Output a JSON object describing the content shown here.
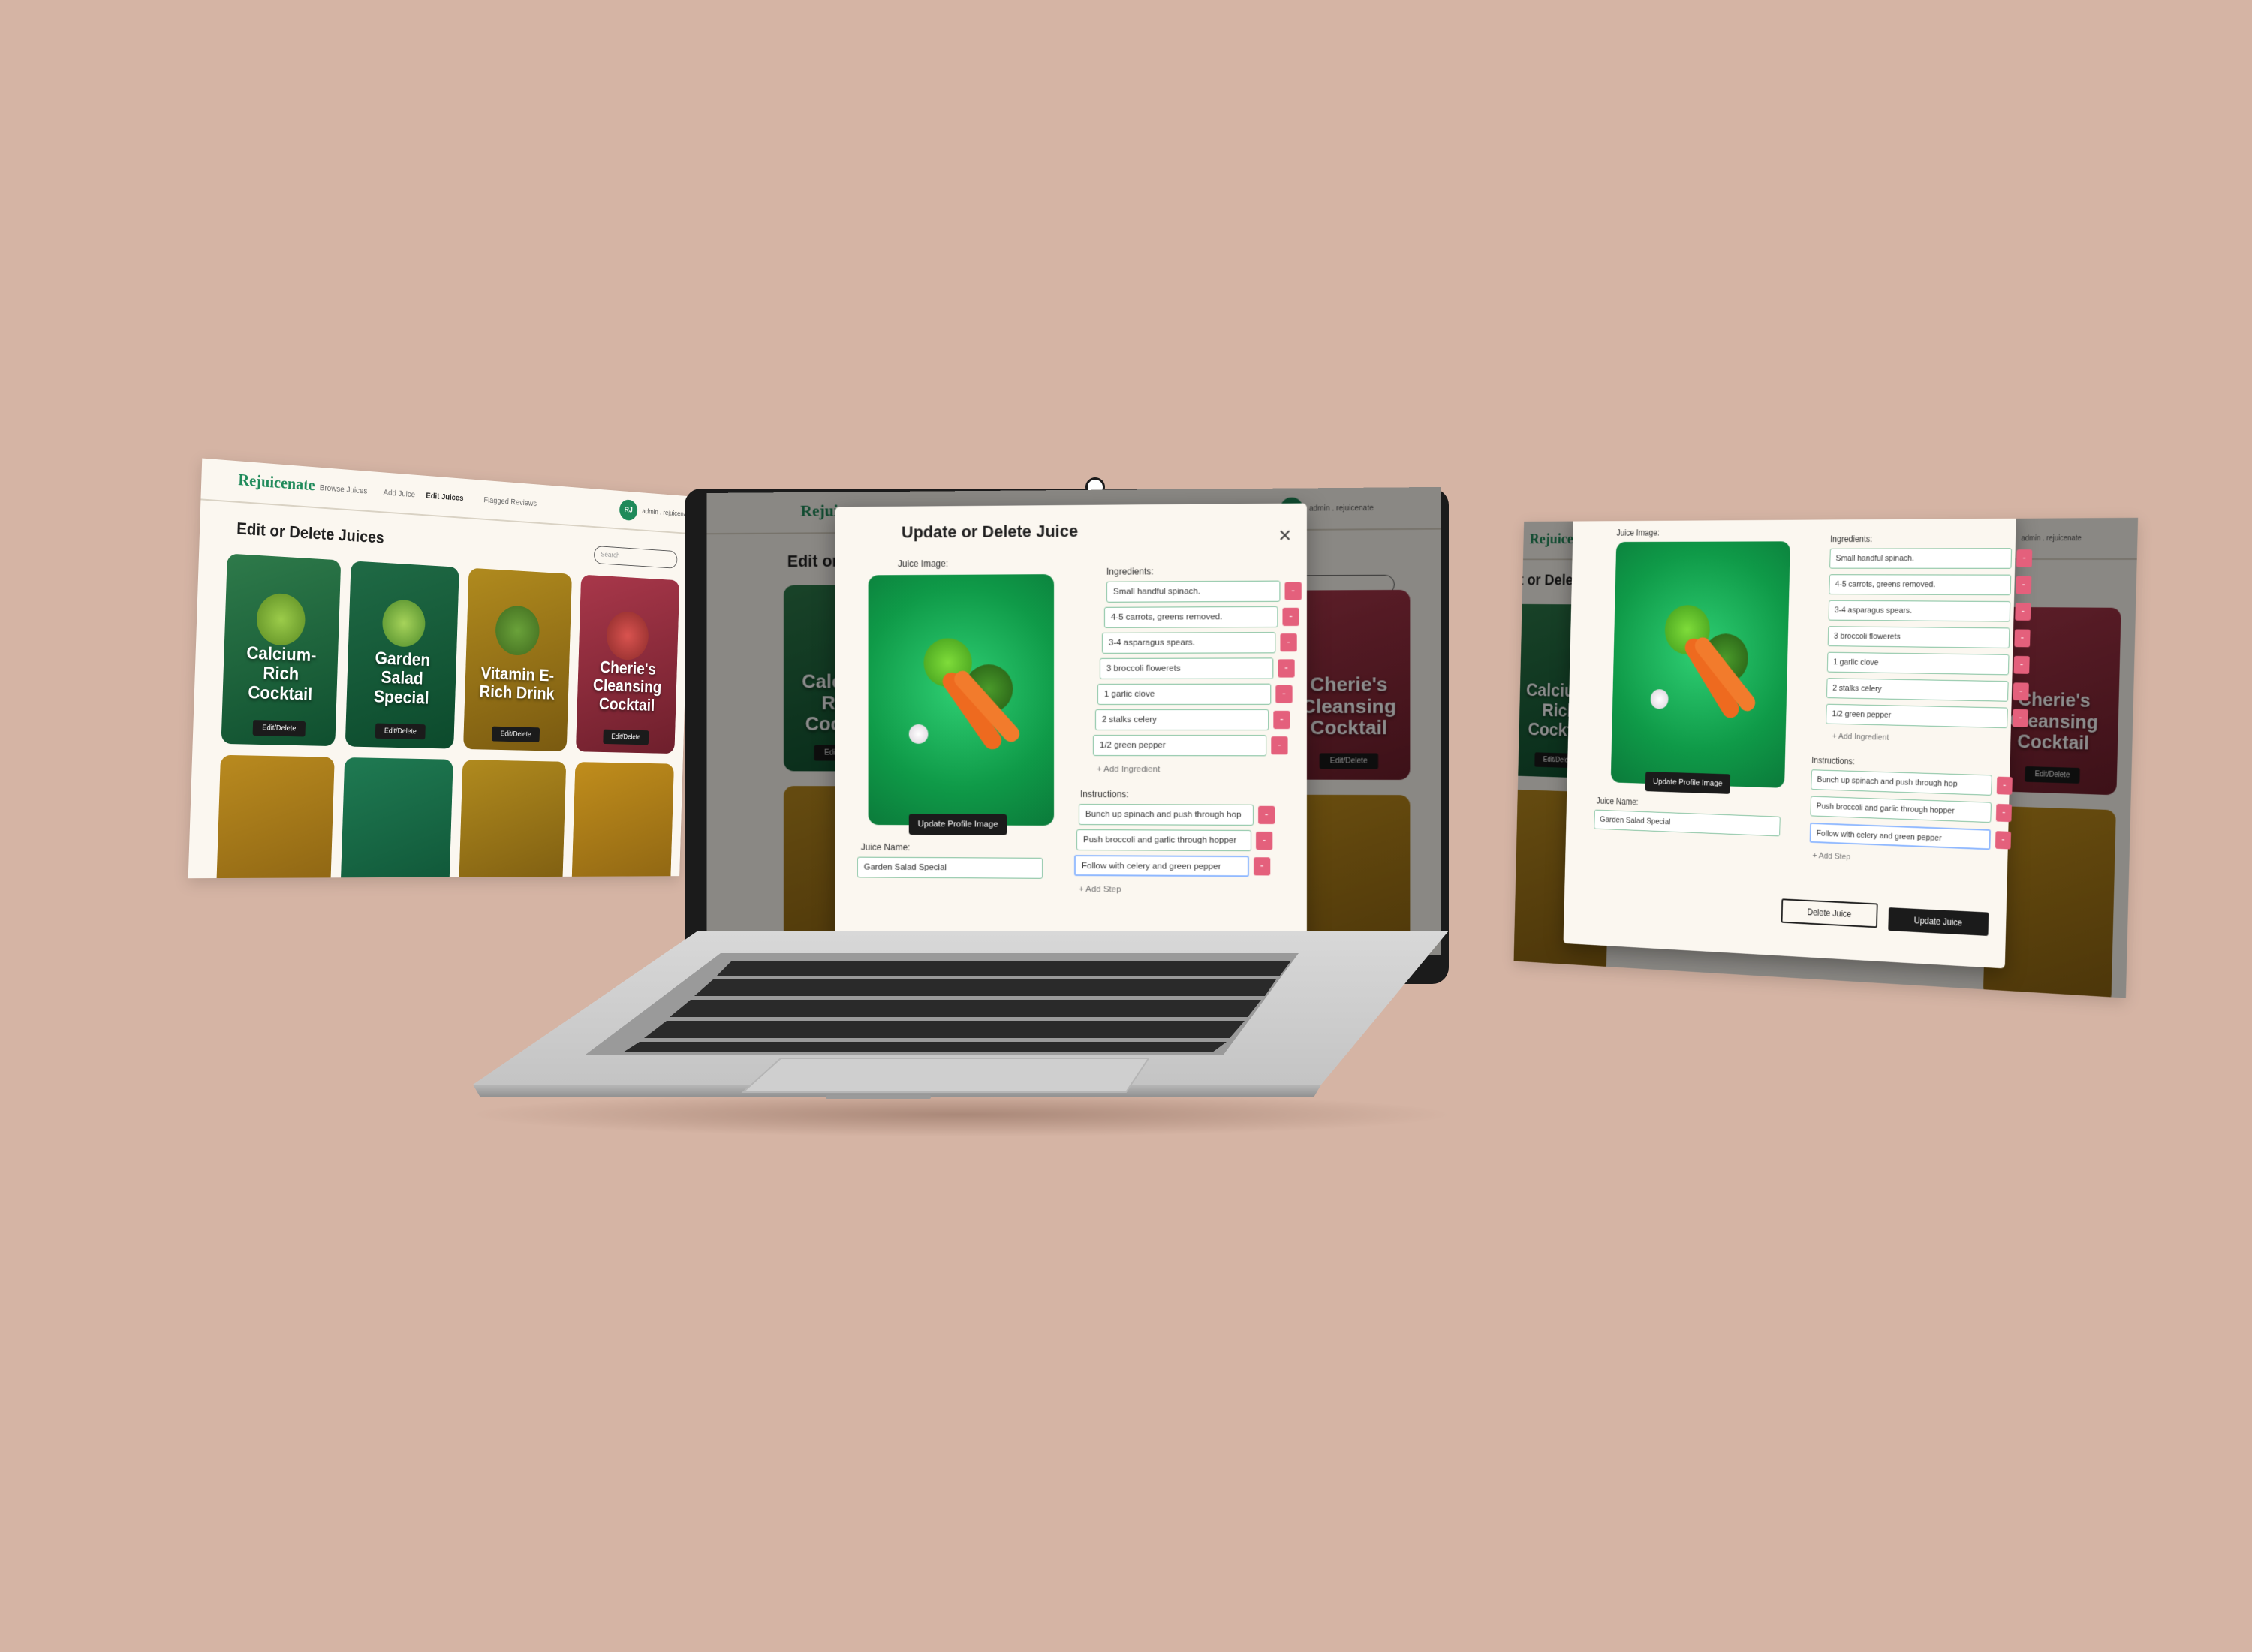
{
  "nav": {
    "logo": "Rejuicenate",
    "links": [
      "Browse Juices",
      "Add Juice",
      "Edit Juices",
      "Flagged Reviews"
    ],
    "avatar_initials": "RJ",
    "user": "admin . rejuicenate"
  },
  "page": {
    "title": "Edit or Delete Juices",
    "search_placeholder": "Search"
  },
  "cards": [
    {
      "name": "Calcium-Rich Cocktail",
      "button": "Edit/Delete"
    },
    {
      "name": "Garden Salad Special",
      "button": "Edit/Delete"
    },
    {
      "name": "Vitamin E-Rich Drink",
      "button": "Edit/Delete"
    },
    {
      "name": "Cherie's Cleansing Cocktail",
      "button": "Edit/Delete"
    }
  ],
  "modal": {
    "title": "Update or Delete Juice",
    "juice_image_label": "Juice Image:",
    "update_image_button": "Update Profile Image",
    "juice_name_label": "Juice Name:",
    "juice_name_value": "Garden Salad Special",
    "ingredients_label": "Ingredients:",
    "ingredients": [
      "Small handful spinach.",
      "4-5 carrots, greens removed.",
      "3-4 asparagus spears.",
      "3 broccoli flowerets",
      "1 garlic clove",
      "2 stalks celery",
      "1/2 green pepper"
    ],
    "add_ingredient": "+ Add Ingredient",
    "instructions_label": "Instructions:",
    "instructions": [
      "Bunch up spinach and push through hop",
      "Push broccoli and garlic through hopper",
      "Follow with celery and green pepper"
    ],
    "add_step": "+ Add Step",
    "delete_button": "Delete Juice",
    "update_button": "Update Juice",
    "remove_symbol": "-"
  },
  "colors": {
    "background": "#d5b4a4",
    "brand_green": "#1f8a5a",
    "page_bg": "#fbf7f0",
    "field_border": "#7fbf9c",
    "remove_button": "#e4607c",
    "dark_button": "#1b1b1b"
  }
}
